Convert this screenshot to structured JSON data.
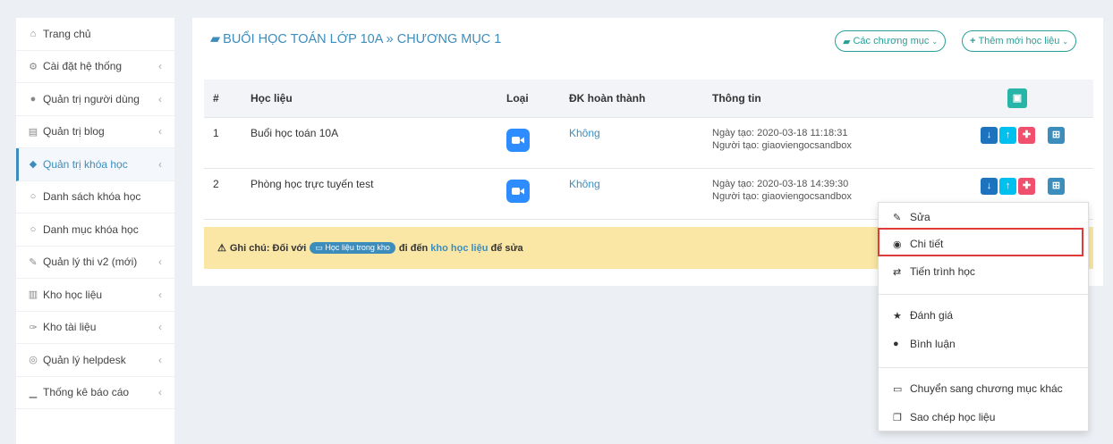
{
  "sidebar": {
    "items": [
      {
        "icon": "home-icon",
        "glyph": "⌂",
        "label": "Trang chủ",
        "chevron": false
      },
      {
        "icon": "gear-icon",
        "glyph": "⚙",
        "label": "Cài đặt hệ thống",
        "chevron": true
      },
      {
        "icon": "user-icon",
        "glyph": "●",
        "label": "Quản trị người dùng",
        "chevron": true
      },
      {
        "icon": "blog-icon",
        "glyph": "▤",
        "label": "Quản trị blog",
        "chevron": true
      },
      {
        "icon": "graduation-cap-icon",
        "glyph": "◆",
        "label": "Quản trị khóa học",
        "chevron": true,
        "active": true
      },
      {
        "icon": "circle-icon",
        "glyph": "○",
        "label": "Danh sách khóa học",
        "chevron": false
      },
      {
        "icon": "circle-icon",
        "glyph": "○",
        "label": "Danh mục khóa học",
        "chevron": false
      },
      {
        "icon": "edit-icon",
        "glyph": "✎",
        "label": "Quản lý thi v2 (mới)",
        "chevron": true
      },
      {
        "icon": "bank-icon",
        "glyph": "▥",
        "label": "Kho học liệu",
        "chevron": true
      },
      {
        "icon": "paperclip-icon",
        "glyph": "✑",
        "label": "Kho tài liệu",
        "chevron": true
      },
      {
        "icon": "life-ring-icon",
        "glyph": "◎",
        "label": "Quản lý helpdesk",
        "chevron": true
      },
      {
        "icon": "bar-chart-icon",
        "glyph": "▁",
        "label": "Thống kê báo cáo",
        "chevron": true
      }
    ],
    "chevron_glyph": "‹"
  },
  "main": {
    "title": "BUỔI HỌC TOÁN LỚP 10A » CHƯƠNG MỤC 1",
    "chapters_button": "Các chương mục",
    "add_button": "Thêm mới học liệu",
    "table": {
      "headers": [
        "#",
        "Học liệu",
        "Loại",
        "ĐK hoàn thành",
        "Thông tin"
      ],
      "rows": [
        {
          "num": "1",
          "name": "Buổi học toán 10A",
          "condition": "Không",
          "created": "Ngày tạo: 2020-03-18 11:18:31",
          "creator": "Người tạo: giaoviengocsandbox"
        },
        {
          "num": "2",
          "name": "Phòng học trực tuyến test",
          "condition": "Không",
          "created": "Ngày tạo: 2020-03-18 14:39:30",
          "creator": "Người tạo: giaoviengocsandbox"
        }
      ]
    },
    "note": {
      "prefix": "Ghi chú: Đối với",
      "tag": "Học liệu trong kho",
      "middle": "đi đến",
      "link": "kho học liệu",
      "suffix": "để sửa"
    }
  },
  "dropdown": {
    "items": [
      {
        "icon": "edit-icon",
        "glyph": "✎",
        "label": "Sửa"
      },
      {
        "icon": "eye-icon",
        "glyph": "◉",
        "label": "Chi tiết"
      },
      {
        "icon": "exchange-icon",
        "glyph": "⇄",
        "label": "Tiến trình học"
      },
      {
        "icon": "star-icon",
        "glyph": "★",
        "label": "Đánh giá"
      },
      {
        "icon": "comments-icon",
        "glyph": "●",
        "label": "Bình luận"
      },
      {
        "icon": "folder-open-icon",
        "glyph": "▭",
        "label": "Chuyển sang chương mục khác"
      },
      {
        "icon": "copy-icon",
        "glyph": "❐",
        "label": "Sao chép học liệu"
      }
    ]
  },
  "colors": {
    "accent": "#3c8dbc",
    "teal": "#28a098",
    "note_bg": "#fae7a5",
    "highlight": "#e03b3b",
    "zoom": "#2d8cff"
  }
}
